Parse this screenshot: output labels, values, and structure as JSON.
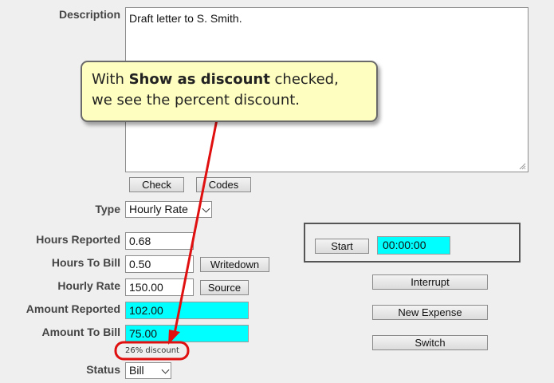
{
  "description": {
    "label": "Description",
    "value": "Draft letter to S. Smith."
  },
  "buttons": {
    "check": "Check",
    "codes": "Codes",
    "writedown": "Writedown",
    "source": "Source",
    "start": "Start",
    "interrupt": "Interrupt",
    "new_expense": "New Expense",
    "switch": "Switch"
  },
  "type": {
    "label": "Type",
    "value": "Hourly Rate"
  },
  "hours_reported": {
    "label": "Hours Reported",
    "value": "0.68"
  },
  "hours_to_bill": {
    "label": "Hours To Bill",
    "value": "0.50"
  },
  "hourly_rate": {
    "label": "Hourly Rate",
    "value": "150.00"
  },
  "amount_reported": {
    "label": "Amount Reported",
    "value": "102.00"
  },
  "amount_to_bill": {
    "label": "Amount To Bill",
    "value": "75.00"
  },
  "discount_note": "26% discount",
  "status": {
    "label": "Status",
    "value": "Bill"
  },
  "timer": {
    "value": "00:00:00"
  },
  "callout": {
    "text_before": "With ",
    "text_bold": "Show as discount",
    "text_after": " checked,",
    "line2": "we see the percent discount."
  },
  "colors": {
    "highlight": "#00ffff",
    "arrow": "#e01010",
    "callout_bg": "#fefec0"
  }
}
